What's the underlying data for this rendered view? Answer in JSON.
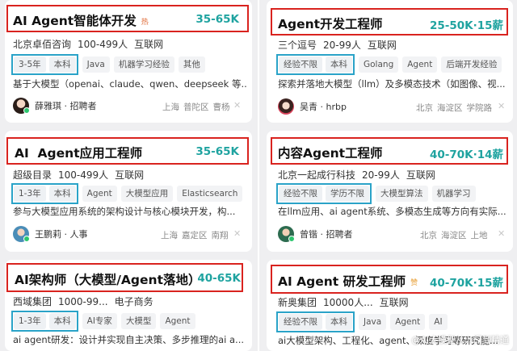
{
  "cards": [
    {
      "title": "AI Agent智能体开发",
      "hot_badge": "热",
      "salary": "35-65K",
      "company": [
        "北京卓佰咨询",
        "100-499人",
        "互联网"
      ],
      "requirements": [
        "3-5年",
        "本科"
      ],
      "tags": [
        "Java",
        "机器学习经验",
        "其他"
      ],
      "description": "基于大模型（openai、claude、qwen、deepseek 等...",
      "recruiter": "薛雅琪 · 招聘者",
      "location": [
        "上海",
        "普陀区",
        "曹杨"
      ]
    },
    {
      "title": "Agent开发工程师",
      "salary": "25-50K·15薪",
      "company": [
        "三个逗号",
        "20-99人",
        "互联网"
      ],
      "requirements": [
        "经验不限",
        "本科"
      ],
      "tags": [
        "Golang",
        "Agent",
        "后端开发经验"
      ],
      "description": "探索并落地大模型（llm）及多模态技术（如图像、视...",
      "recruiter": "吴青 · hrbp",
      "location": [
        "北京",
        "海淀区",
        "学院路"
      ]
    },
    {
      "title": "AI  Agent应用工程师",
      "salary": "35-65K",
      "company": [
        "超级目录",
        "100-499人",
        "互联网"
      ],
      "requirements": [
        "1-3年",
        "本科"
      ],
      "tags": [
        "Agent",
        "大模型应用",
        "Elasticsearch"
      ],
      "description": "参与大模型应用系统的架构设计与核心模块开发，构...",
      "recruiter": "王鹏莉 · 人事",
      "location": [
        "上海",
        "嘉定区",
        "南翔"
      ]
    },
    {
      "title": "内容Agent工程师",
      "salary": "40-70K·14薪",
      "company": [
        "北京一起成行科技",
        "20-99人",
        "互联网"
      ],
      "requirements": [
        "经验不限",
        "学历不限"
      ],
      "tags": [
        "大模型算法",
        "机器学习"
      ],
      "description": "在llm应用、ai agent系统、多模态生成等方向有实际...",
      "recruiter": "曾锴 · 招聘者",
      "location": [
        "北京",
        "海淀区",
        "上地"
      ]
    },
    {
      "title": "AI架构师（大模型/Agent落地）",
      "salary": "40-65K",
      "company": [
        "西域集团",
        "1000-99...",
        "电子商务"
      ],
      "requirements": [
        "1-3年",
        "本科"
      ],
      "tags": [
        "AI专家",
        "大模型",
        "Agent"
      ],
      "description": "ai agent研发：设计并实现自主决策、多步推理的ai a..."
    },
    {
      "title": "AI Agent 研发工程师",
      "hot_badge": "赞",
      "salary": "40-70K·15薪",
      "company": [
        "新奥集团",
        "10000人...",
        "互联网"
      ],
      "requirements": [
        "经验不限",
        "本科"
      ],
      "tags": [
        "Java",
        "Agent",
        "AI"
      ],
      "description": "ai大模型架构、工程化、agent、深度学习等研究能..."
    }
  ],
  "watermark": "@AI大模型从入门到精通",
  "colors": {
    "accent_teal": "#1fa3a0",
    "highlight_red": "#d9231f",
    "highlight_blue": "#2aa3c8"
  }
}
